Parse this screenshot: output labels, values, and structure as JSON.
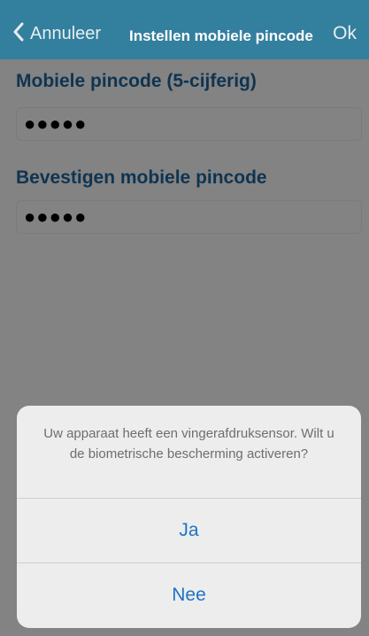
{
  "navbar": {
    "back_label": "Annuleer",
    "title": "Instellen mobiele pincode",
    "ok_label": "Ok",
    "back_icon": "chevron-left-icon"
  },
  "form": {
    "pin_label": "Mobiele pincode (5-cijferig)",
    "pin_value": "●●●●●",
    "confirm_label": "Bevestigen mobiele pincode",
    "confirm_value": "●●●●●"
  },
  "sheet": {
    "message": "Uw apparaat heeft een vingerafdruksensor. Wilt u de biometrische bescherming activeren?",
    "yes_label": "Ja",
    "no_label": "Nee"
  },
  "colors": {
    "navbar": "#337f9e",
    "label": "#0f3451",
    "action": "#1d74c7",
    "overlay": "#838383"
  }
}
